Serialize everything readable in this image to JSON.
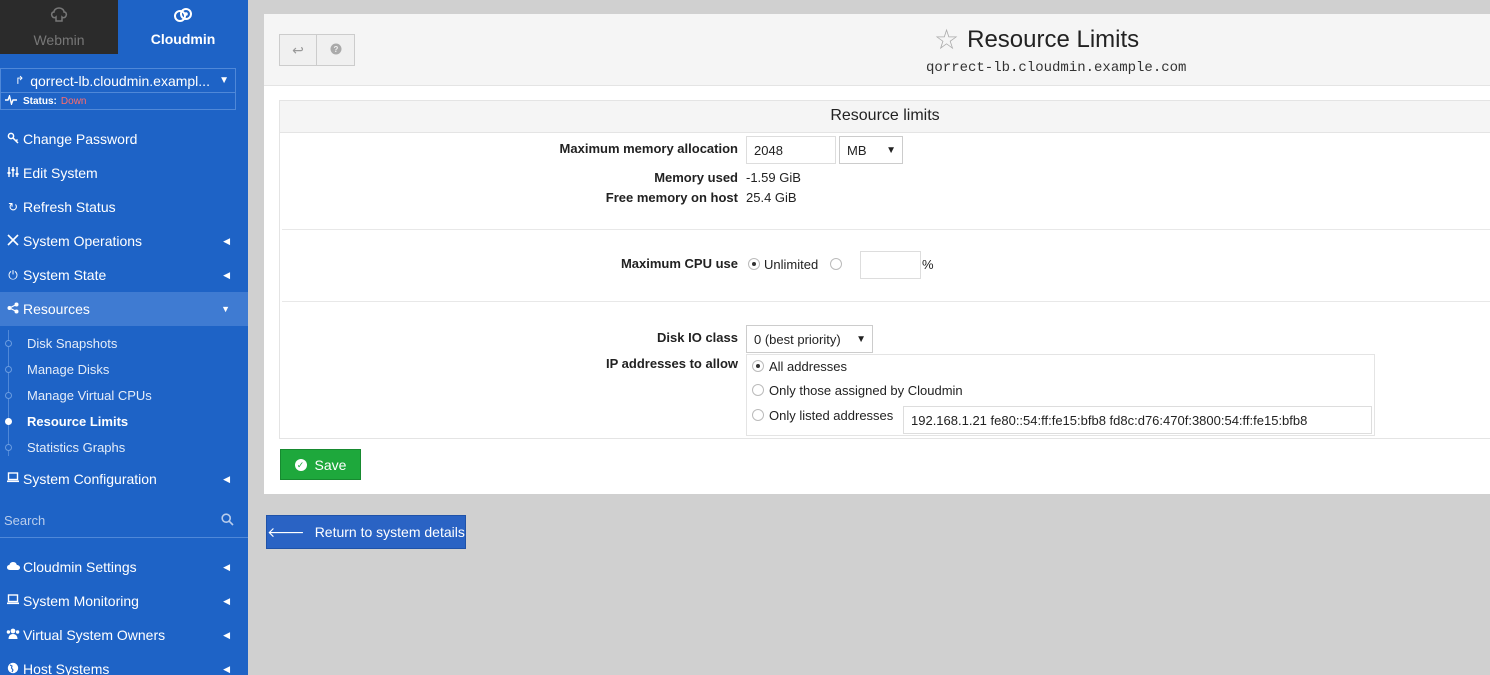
{
  "sidebar": {
    "tabs": [
      {
        "label": "Webmin",
        "icon": "webmin-icon"
      },
      {
        "label": "Cloudmin",
        "icon": "cloudmin-icon"
      }
    ],
    "host": {
      "name": "qorrect-lb.cloudmin.exampl...",
      "status_label": "Status:",
      "status_value": "Down"
    },
    "items": [
      {
        "label": "Change Password",
        "icon": "key-icon"
      },
      {
        "label": "Edit System",
        "icon": "sliders-icon"
      },
      {
        "label": "Refresh Status",
        "icon": "refresh-icon"
      },
      {
        "label": "System Operations",
        "icon": "tools-icon"
      },
      {
        "label": "System State",
        "icon": "power-icon"
      },
      {
        "label": "Resources",
        "icon": "share-icon"
      }
    ],
    "resources_sub": [
      {
        "label": "Disk Snapshots"
      },
      {
        "label": "Manage Disks"
      },
      {
        "label": "Manage Virtual CPUs"
      },
      {
        "label": "Resource Limits"
      },
      {
        "label": "Statistics Graphs"
      }
    ],
    "system_configuration": {
      "label": "System Configuration",
      "icon": "laptop-icon"
    },
    "search_placeholder": "Search",
    "bottom_items": [
      {
        "label": "Cloudmin Settings",
        "icon": "cloud-icon"
      },
      {
        "label": "System Monitoring",
        "icon": "laptop-icon"
      },
      {
        "label": "Virtual System Owners",
        "icon": "users-icon"
      },
      {
        "label": "Host Systems",
        "icon": "globe-icon"
      }
    ]
  },
  "header": {
    "title": "Resource Limits",
    "subtitle": "qorrect-lb.cloudmin.example.com"
  },
  "form": {
    "section_title": "Resource limits",
    "max_memory": {
      "label": "Maximum memory allocation",
      "value": "2048",
      "unit": "MB"
    },
    "memory_used": {
      "label": "Memory used",
      "value": "-1.59 GiB"
    },
    "free_memory": {
      "label": "Free memory on host",
      "value": "25.4 GiB"
    },
    "max_cpu": {
      "label": "Maximum CPU use",
      "option_unlimited": "Unlimited",
      "percent_value": "",
      "percent_suffix": "%"
    },
    "disk_io": {
      "label": "Disk IO class",
      "value": "0 (best priority)"
    },
    "ip_allow": {
      "label": "IP addresses to allow",
      "option_all": "All addresses",
      "option_assigned": "Only those assigned by Cloudmin",
      "option_listed": "Only listed addresses",
      "listed_value": "192.168.1.21 fe80::54:ff:fe15:bfb8 fd8c:d76:470f:3800:54:ff:fe15:bfb8"
    },
    "save_label": "Save"
  },
  "return_label": "Return to system details",
  "colors": {
    "sidebar_bg": "#1e63c6",
    "save_green": "#1ea83c",
    "return_blue": "#2a63c4",
    "status_down": "#ff6b6b"
  }
}
